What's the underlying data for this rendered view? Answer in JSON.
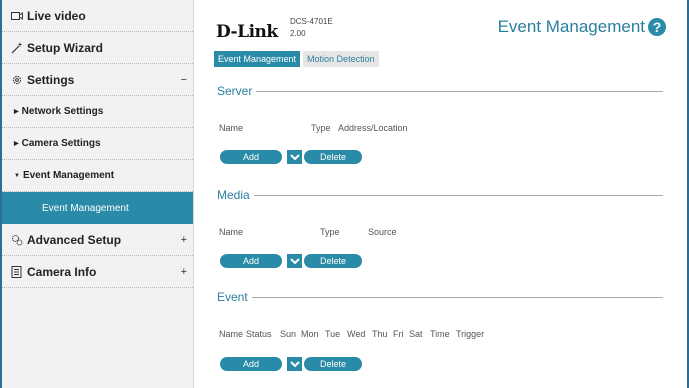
{
  "sidebar": {
    "items": [
      {
        "label": "Live video",
        "icon": "video-icon"
      },
      {
        "label": "Setup Wizard",
        "icon": "wand-icon"
      },
      {
        "label": "Settings",
        "icon": "gear-icon",
        "sign": "−"
      },
      {
        "label": "Network Settings"
      },
      {
        "label": "Camera Settings"
      },
      {
        "label": "Event Management"
      },
      {
        "label": "Event Management"
      },
      {
        "label": "Advanced Setup",
        "icon": "gears-icon",
        "sign": "+"
      },
      {
        "label": "Camera Info",
        "icon": "document-icon",
        "sign": "+"
      }
    ]
  },
  "header": {
    "logo": "D-Link",
    "model": "DCS-4701E",
    "version": "2.00",
    "title": "Event Management",
    "help": "?"
  },
  "tabs": [
    "Event Management",
    "Motion Detection"
  ],
  "server": {
    "title": "Server",
    "columns": [
      "Name",
      "Type",
      "Address/Location"
    ],
    "add": "Add",
    "delete": "Delete"
  },
  "media": {
    "title": "Media",
    "columns": [
      "Name",
      "Type",
      "Source"
    ],
    "add": "Add",
    "delete": "Delete"
  },
  "event": {
    "title": "Event",
    "columns": [
      "Name",
      "Status",
      "Sun",
      "Mon",
      "Tue",
      "Wed",
      "Thu",
      "Fri",
      "Sat",
      "Time",
      "Trigger"
    ],
    "add": "Add",
    "delete": "Delete"
  },
  "colors": {
    "accent": "#2a8ba8",
    "title": "#2a7f9e"
  }
}
